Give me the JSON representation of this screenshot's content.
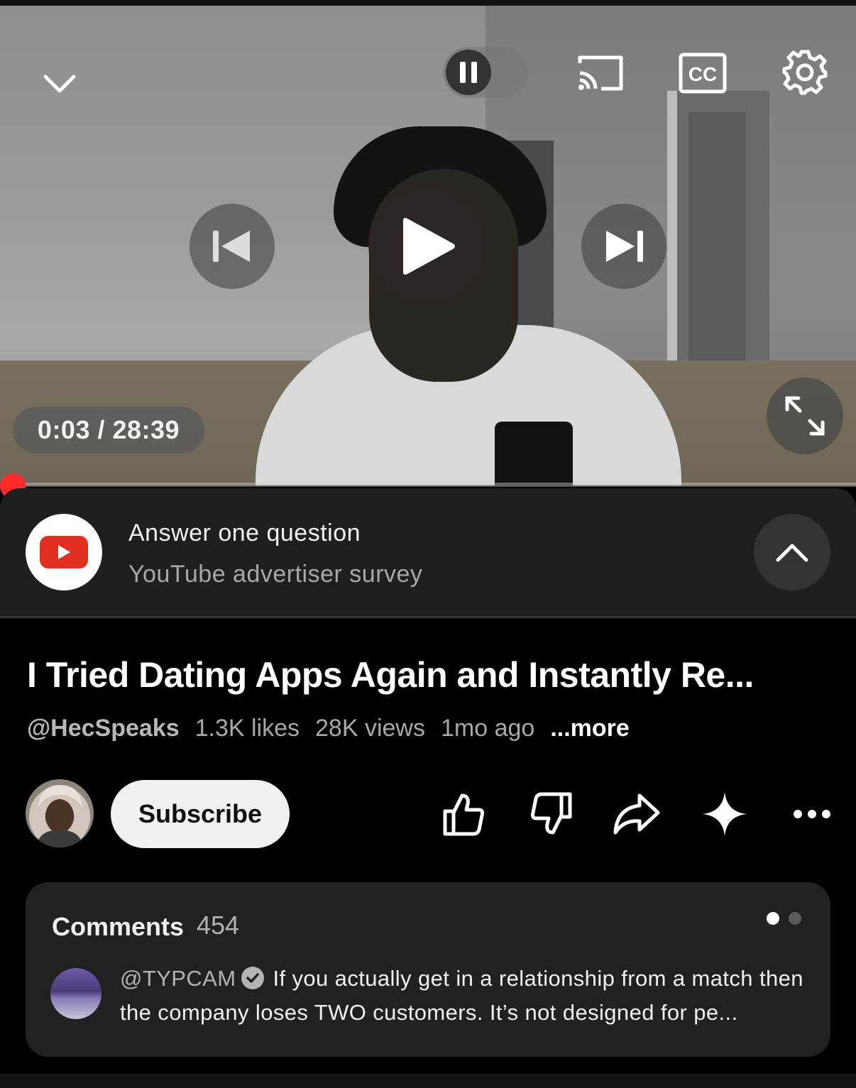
{
  "player": {
    "time_display": "0:03 / 28:39",
    "progress_fraction": 0.002,
    "icons": {
      "minimize": "chevron-down-icon",
      "autoplay": "pause-icon",
      "cast": "cast-icon",
      "captions": "cc-icon",
      "settings": "gear-icon",
      "previous": "skip-previous-icon",
      "play": "play-icon",
      "next": "skip-next-icon",
      "fullscreen": "fullscreen-icon"
    },
    "captions_label": "CC",
    "accent_color": "#ff0000"
  },
  "survey": {
    "title": "Answer one question",
    "subtitle": "YouTube advertiser survey"
  },
  "video": {
    "title": "I Tried Dating Apps Again and Instantly Re...",
    "channel_handle": "@HecSpeaks",
    "likes": "1.3K likes",
    "views": "28K views",
    "age": "1mo ago",
    "more_label": "...more"
  },
  "actions": {
    "subscribe_label": "Subscribe",
    "icons": [
      "thumbs-up-icon",
      "thumbs-down-icon",
      "share-icon",
      "sparkle-icon",
      "more-icon"
    ]
  },
  "comments": {
    "title": "Comments",
    "count": "454",
    "top_comment": {
      "user": "@TYPCAM",
      "text": "If you actually get in a relationship from a match then the company loses TWO customers. It’s not designed for pe..."
    }
  }
}
